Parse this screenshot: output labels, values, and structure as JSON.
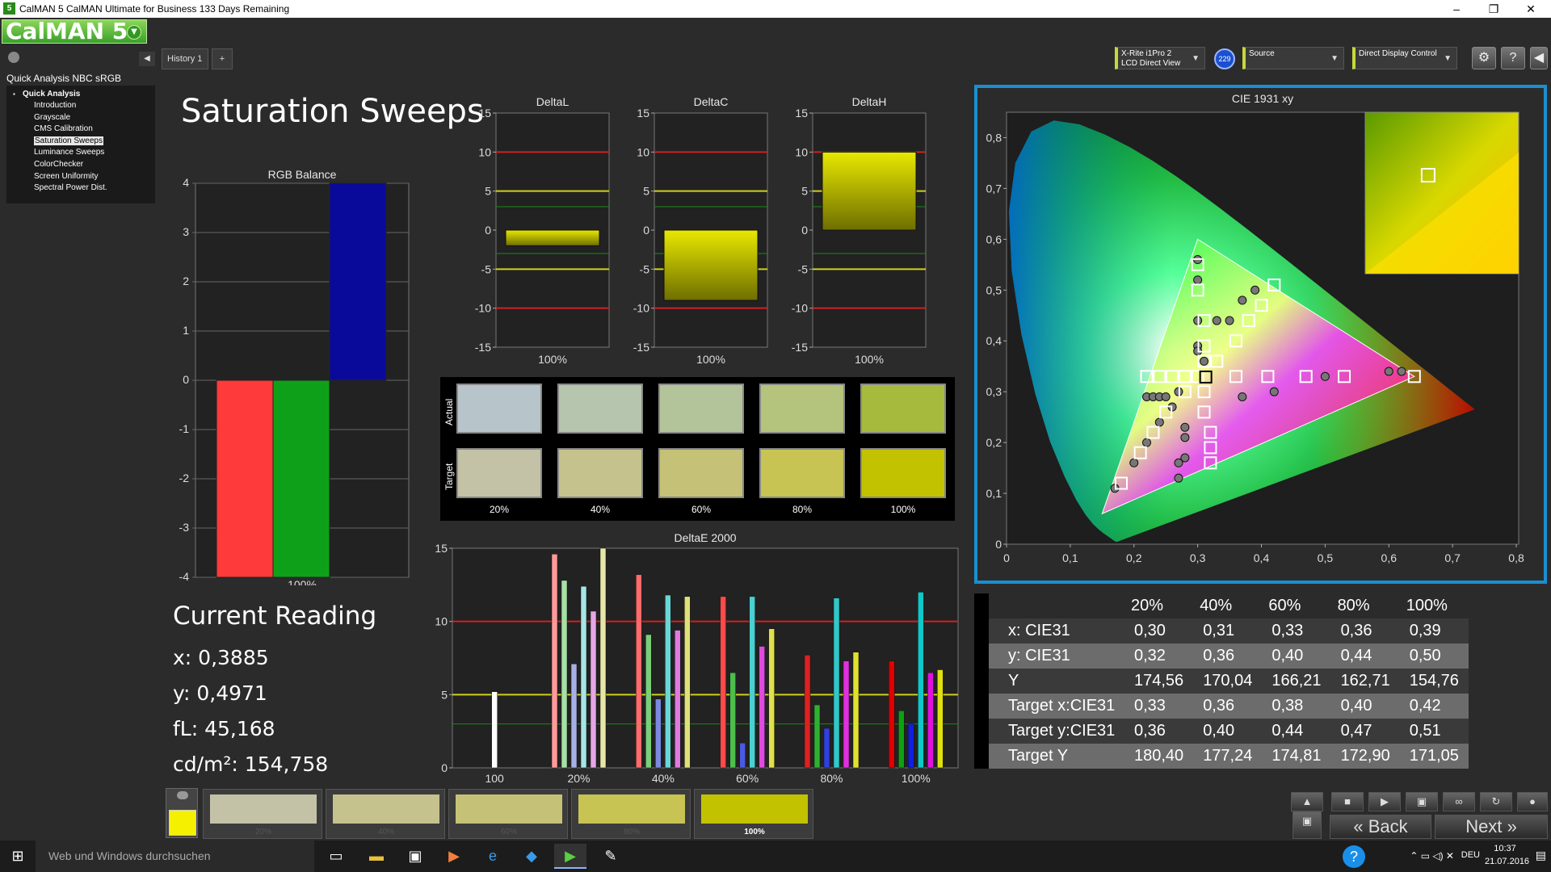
{
  "window": {
    "title": "CalMAN 5 CalMAN Ultimate for Business 133 Days Remaining",
    "app_icon_text": "5",
    "minimize": "–",
    "maximize": "❐",
    "close": "✕"
  },
  "logo": {
    "text": "CalMAN 5"
  },
  "history_tab": {
    "label": "History 1",
    "add": "+"
  },
  "devices": {
    "meter": {
      "line1": "X-Rite i1Pro 2",
      "line2": "LCD Direct View",
      "badge": "229"
    },
    "source": {
      "label": "Source"
    },
    "display": {
      "label": "Direct Display Control"
    }
  },
  "toolbar_icons": [
    "gear-icon",
    "help-icon",
    "collapse-icon"
  ],
  "sidebar": {
    "title": "Quick Analysis NBC sRGB",
    "group": "Quick Analysis",
    "items": [
      {
        "label": "Introduction",
        "selected": false
      },
      {
        "label": "Grayscale",
        "selected": false
      },
      {
        "label": "CMS Calibration",
        "selected": false
      },
      {
        "label": "Saturation Sweeps",
        "selected": true
      },
      {
        "label": "Luminance Sweeps",
        "selected": false
      },
      {
        "label": "ColorChecker",
        "selected": false
      },
      {
        "label": "Screen Uniformity",
        "selected": false
      },
      {
        "label": "Spectral Power Dist.",
        "selected": false
      }
    ]
  },
  "page": {
    "title": "Saturation Sweeps"
  },
  "rgb_balance": {
    "title": "RGB Balance",
    "xlabel": "100%",
    "ylim": [
      -4,
      4
    ],
    "ticks": [
      "4",
      "3",
      "2",
      "1",
      "0",
      "-1",
      "-2",
      "-3",
      "-4"
    ],
    "values": {
      "red": -4.0,
      "green": -4.0,
      "blue": 4.0
    },
    "colors": {
      "red": "#ff3a3a",
      "green": "#0fa01a",
      "blue": "#0a0a9a"
    }
  },
  "delta_charts": [
    {
      "title": "DeltaL",
      "xlabel": "100%",
      "value": -2.0
    },
    {
      "title": "DeltaC",
      "xlabel": "100%",
      "value": -9.0
    },
    {
      "title": "DeltaH",
      "xlabel": "100%",
      "value": 10.0
    }
  ],
  "delta_ticks": [
    "15",
    "10",
    "5",
    "0",
    "-5",
    "-10",
    "-15"
  ],
  "swatches": {
    "row_actual": "Actual",
    "row_target": "Target",
    "columns": [
      "20%",
      "40%",
      "60%",
      "80%",
      "100%"
    ],
    "actual_colors": [
      "#b7c4c9",
      "#b5c5ae",
      "#b4c49a",
      "#b4c47c",
      "#a6bb3d"
    ],
    "target_colors": [
      "#c3c2a6",
      "#c5c28e",
      "#c5c277",
      "#c7c454",
      "#c3c200"
    ]
  },
  "deltae_chart": {
    "title": "DeltaE 2000",
    "ticks": [
      "15",
      "10",
      "5",
      "0"
    ],
    "categories": [
      "100",
      "20%",
      "40%",
      "60%",
      "80%",
      "100%"
    ],
    "ylim": [
      0,
      15
    ],
    "groups": [
      [
        5.2
      ],
      [
        14.6,
        12.8,
        7.1,
        12.4,
        10.7,
        15.0
      ],
      [
        13.2,
        9.1,
        4.7,
        11.8,
        9.4,
        11.7
      ],
      [
        11.7,
        6.5,
        1.7,
        11.7,
        8.3,
        9.5
      ],
      [
        7.7,
        4.3,
        2.7,
        11.6,
        7.3,
        7.9
      ],
      [
        7.3,
        3.9,
        3.0,
        12.0,
        6.5,
        6.7
      ]
    ],
    "group_colors": [
      [
        "#ffffff"
      ],
      [
        "#ff9a9a",
        "#a6e0a6",
        "#a6b0e6",
        "#a6e6e6",
        "#e6a6e6",
        "#e6e6a6"
      ],
      [
        "#ff6a6a",
        "#7ad07a",
        "#7a8ae0",
        "#6ad6d6",
        "#e07ae0",
        "#e0e07a"
      ],
      [
        "#ff4a4a",
        "#4ac04a",
        "#4a5ae0",
        "#4ad0d0",
        "#e04ae0",
        "#e0e04a"
      ],
      [
        "#e02020",
        "#30b030",
        "#3040e0",
        "#30c8c8",
        "#e030e0",
        "#e0e030"
      ],
      [
        "#e00000",
        "#10a010",
        "#1020e0",
        "#10c8c8",
        "#e010e0",
        "#e0e010"
      ]
    ]
  },
  "current_reading": {
    "title": "Current Reading",
    "x": "x: 0,3885",
    "y": "y: 0,4971",
    "fl": "fL: 45,168",
    "cdm2": "cd/m²: 154,758"
  },
  "cie": {
    "title": "CIE 1931 xy",
    "x_ticks": [
      "0",
      "0,1",
      "0,2",
      "0,3",
      "0,4",
      "0,5",
      "0,6",
      "0,7",
      "0,8"
    ],
    "y_ticks": [
      "0,8",
      "0,7",
      "0,6",
      "0,5",
      "0,4",
      "0,3",
      "0,2",
      "0,1",
      "0"
    ],
    "gamut": {
      "red": [
        0.64,
        0.33
      ],
      "green": [
        0.3,
        0.6
      ],
      "blue": [
        0.15,
        0.06
      ],
      "white": [
        0.3127,
        0.329
      ]
    },
    "targets": [
      [
        0.18,
        0.12
      ],
      [
        0.21,
        0.18
      ],
      [
        0.23,
        0.22
      ],
      [
        0.25,
        0.26
      ],
      [
        0.28,
        0.3
      ],
      [
        0.22,
        0.33
      ],
      [
        0.24,
        0.33
      ],
      [
        0.26,
        0.33
      ],
      [
        0.28,
        0.33
      ],
      [
        0.3,
        0.33
      ],
      [
        0.3,
        0.55
      ],
      [
        0.3,
        0.5
      ],
      [
        0.31,
        0.44
      ],
      [
        0.31,
        0.39
      ],
      [
        0.31,
        0.36
      ],
      [
        0.36,
        0.33
      ],
      [
        0.41,
        0.33
      ],
      [
        0.47,
        0.33
      ],
      [
        0.53,
        0.33
      ],
      [
        0.64,
        0.33
      ],
      [
        0.31,
        0.3
      ],
      [
        0.31,
        0.26
      ],
      [
        0.32,
        0.22
      ],
      [
        0.32,
        0.19
      ],
      [
        0.32,
        0.16
      ],
      [
        0.33,
        0.36
      ],
      [
        0.36,
        0.4
      ],
      [
        0.38,
        0.44
      ],
      [
        0.4,
        0.47
      ],
      [
        0.42,
        0.51
      ]
    ],
    "measured": [
      [
        0.17,
        0.11
      ],
      [
        0.2,
        0.16
      ],
      [
        0.22,
        0.2
      ],
      [
        0.24,
        0.24
      ],
      [
        0.26,
        0.27
      ],
      [
        0.22,
        0.29
      ],
      [
        0.23,
        0.29
      ],
      [
        0.24,
        0.29
      ],
      [
        0.25,
        0.29
      ],
      [
        0.27,
        0.3
      ],
      [
        0.3,
        0.56
      ],
      [
        0.3,
        0.52
      ],
      [
        0.3,
        0.44
      ],
      [
        0.3,
        0.39
      ],
      [
        0.31,
        0.36
      ],
      [
        0.37,
        0.29
      ],
      [
        0.42,
        0.3
      ],
      [
        0.5,
        0.33
      ],
      [
        0.6,
        0.34
      ],
      [
        0.62,
        0.34
      ],
      [
        0.28,
        0.23
      ],
      [
        0.28,
        0.21
      ],
      [
        0.27,
        0.16
      ],
      [
        0.28,
        0.17
      ],
      [
        0.27,
        0.13
      ],
      [
        0.3,
        0.38
      ],
      [
        0.33,
        0.44
      ],
      [
        0.35,
        0.44
      ],
      [
        0.37,
        0.48
      ],
      [
        0.39,
        0.5
      ]
    ],
    "current": [
      0.3885,
      0.4971
    ],
    "inset_marker": [
      0.72,
      0.72
    ]
  },
  "table": {
    "headers": [
      "",
      "20%",
      "40%",
      "60%",
      "80%",
      "100%"
    ],
    "rows": [
      {
        "label": "x: CIE31",
        "values": [
          "0,30",
          "0,31",
          "0,33",
          "0,36",
          "0,39"
        ]
      },
      {
        "label": "y: CIE31",
        "values": [
          "0,32",
          "0,36",
          "0,40",
          "0,44",
          "0,50"
        ]
      },
      {
        "label": "Y",
        "values": [
          "174,56",
          "170,04",
          "166,21",
          "162,71",
          "154,76"
        ]
      },
      {
        "label": "Target x:CIE31",
        "values": [
          "0,33",
          "0,36",
          "0,38",
          "0,40",
          "0,42"
        ]
      },
      {
        "label": "Target y:CIE31",
        "values": [
          "0,36",
          "0,40",
          "0,44",
          "0,47",
          "0,51"
        ]
      },
      {
        "label": "Target Y",
        "values": [
          "180,40",
          "177,24",
          "174,81",
          "172,90",
          "171,05"
        ]
      }
    ]
  },
  "bottom": {
    "current_color": "#f4f000",
    "patches": [
      {
        "label": "20%",
        "color": "#c3c2a6"
      },
      {
        "label": "40%",
        "color": "#c5c28e"
      },
      {
        "label": "60%",
        "color": "#c5c277"
      },
      {
        "label": "80%",
        "color": "#c7c454"
      },
      {
        "label": "100%",
        "color": "#c3c200"
      }
    ],
    "back": "Back",
    "next": "Next"
  },
  "taskbar": {
    "search": "Web und Windows durchsuchen",
    "lang": "DEU",
    "time": "10:37",
    "date": "21.07.2016"
  }
}
